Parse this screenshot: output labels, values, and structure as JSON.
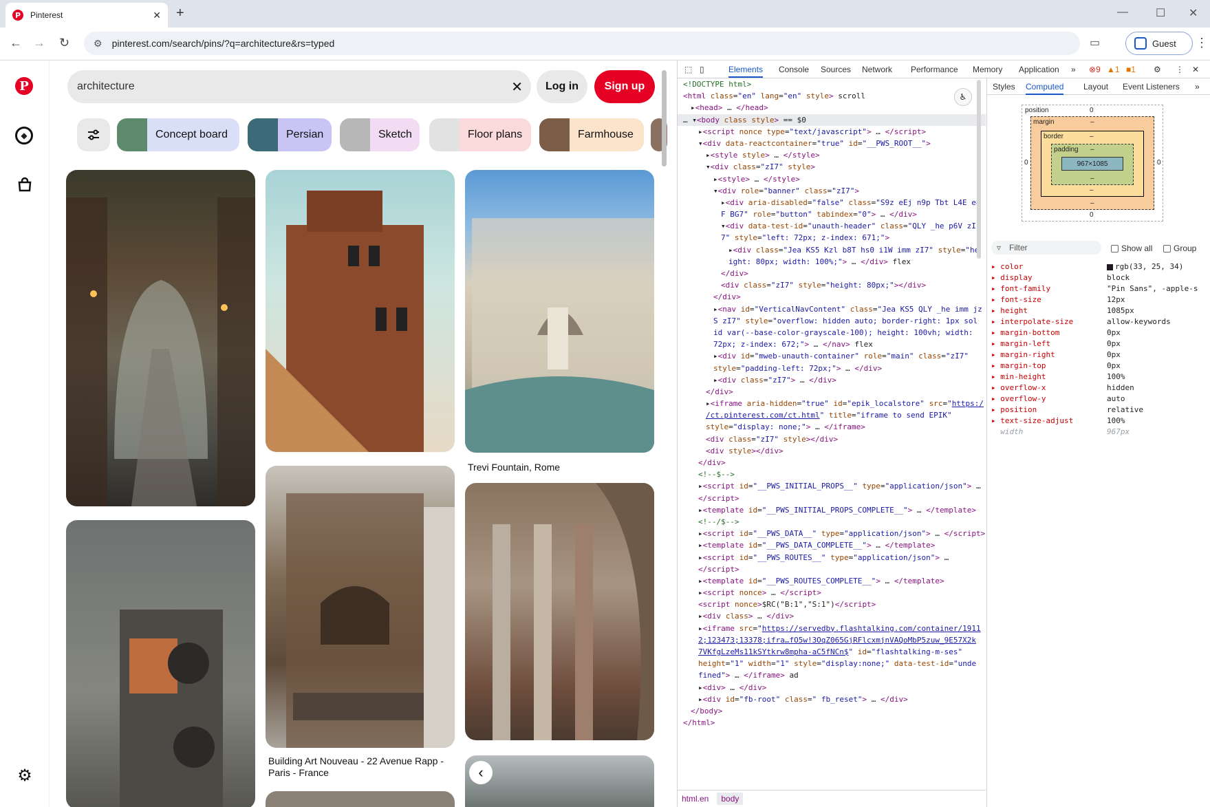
{
  "browser": {
    "tab_title": "Pinterest",
    "favicon_letter": "P",
    "new_tab": "+",
    "tab_close": "✕",
    "url": "pinterest.com/search/pins/?q=architecture&rs=typed",
    "profile": "Guest",
    "win_min": "—",
    "win_max": "☐",
    "win_close": "✕",
    "back": "←",
    "forward": "→",
    "reload": "↻"
  },
  "pinterest": {
    "logo": "P",
    "search_value": "architecture",
    "clear": "✕",
    "login": "Log in",
    "signup": "Sign up",
    "brand_color": "#e60023",
    "filters_icon": "⚙",
    "chips": [
      {
        "label": "Concept board",
        "color": "#dadff8",
        "thumb": "#5d8a6d"
      },
      {
        "label": "Persian",
        "color": "#c8c5f5",
        "thumb": "#3d6a78"
      },
      {
        "label": "Sketch",
        "color": "#f2dcf4",
        "thumb": "#b7b7b7"
      },
      {
        "label": "Floor plans",
        "color": "#fbdadc",
        "thumb": "#e2e2e2"
      },
      {
        "label": "Farmhouse",
        "color": "#fbe3cc",
        "thumb": "#7b5d48"
      }
    ],
    "captions": {
      "trevi": "Trevi Fountain, Rome",
      "nouveau_1": "Building Art Nouveau - 22 Avenue Rapp -",
      "nouveau_2": "Paris - France"
    },
    "carousel_prev": "‹"
  },
  "devtools": {
    "tabs": [
      "Elements",
      "Console",
      "Sources",
      "Network",
      "Performance",
      "Memory",
      "Application"
    ],
    "active_tab": "Elements",
    "more": "»",
    "errors": "9",
    "warnings": "1",
    "issues": "1",
    "dom_lines": [
      {
        "i": 0,
        "h": "<span class='cm'>&lt;!DOCTYPE html&gt;</span>"
      },
      {
        "i": 0,
        "h": "<span class='tg'>&lt;html</span> <span class='at'>class</span>=<span class='av'>\"en\"</span> <span class='at'>lang</span>=<span class='av'>\"en\"</span> <span class='at'>style</span><span class='tg'>&gt;</span> <span class='tx'>scroll</span>"
      },
      {
        "i": 1,
        "h": "▸<span class='tg'>&lt;head&gt;</span> … <span class='tg'>&lt;/head&gt;</span>"
      },
      {
        "i": 0,
        "h": "… ▾<span class='tg'>&lt;body</span> <span class='at'>class style</span><span class='tg'>&gt;</span> == $0",
        "sel": true
      },
      {
        "i": 2,
        "h": "▸<span class='tg'>&lt;script</span> <span class='at'>nonce type</span>=<span class='av'>\"text/javascript\"</span><span class='tg'>&gt;</span> … <span class='tg'>&lt;/script&gt;</span>"
      },
      {
        "i": 2,
        "h": "▾<span class='tg'>&lt;div</span> <span class='at'>data-reactcontainer</span>=<span class='av'>\"true\"</span> <span class='at'>id</span>=<span class='av'>\"__PWS_ROOT__\"</span><span class='tg'>&gt;</span>"
      },
      {
        "i": 3,
        "h": "▸<span class='tg'>&lt;style</span> <span class='at'>style</span><span class='tg'>&gt;</span> … <span class='tg'>&lt;/style&gt;</span>"
      },
      {
        "i": 3,
        "h": "▾<span class='tg'>&lt;div</span> <span class='at'>class</span>=<span class='av'>\"zI7\"</span> <span class='at'>style</span><span class='tg'>&gt;</span>"
      },
      {
        "i": 4,
        "h": "▸<span class='tg'>&lt;style&gt;</span> … <span class='tg'>&lt;/style&gt;</span>"
      },
      {
        "i": 4,
        "h": "▾<span class='tg'>&lt;div</span> <span class='at'>role</span>=<span class='av'>\"banner\"</span> <span class='at'>class</span>=<span class='av'>\"zI7\"</span><span class='tg'>&gt;</span>"
      },
      {
        "i": 5,
        "h": "▸<span class='tg'>&lt;div</span> <span class='at'>aria-disabled</span>=<span class='av'>\"false\"</span> <span class='at'>class</span>=<span class='av'>\"S9z eEj n9p Tbt L4E e8</span>"
      },
      {
        "i": 5,
        "h": "<span class='av'>F BG7\"</span> <span class='at'>role</span>=<span class='av'>\"button\"</span> <span class='at'>tabindex</span>=<span class='av'>\"0\"</span><span class='tg'>&gt;</span> … <span class='tg'>&lt;/div&gt;</span>"
      },
      {
        "i": 5,
        "h": "▾<span class='tg'>&lt;div</span> <span class='at'>data-test-id</span>=<span class='av'>\"unauth-header\"</span> <span class='at'>class</span>=<span class='av'>\"QLY _he p6V zI</span>"
      },
      {
        "i": 5,
        "h": "<span class='av'>7\"</span> <span class='at'>style</span>=<span class='av'>\"left: 72px; z-index: 671;\"</span><span class='tg'>&gt;</span>"
      },
      {
        "i": 6,
        "h": "▸<span class='tg'>&lt;div</span> <span class='at'>class</span>=<span class='av'>\"Jea KS5 Kzl b8T hs0 i1W imm zI7\"</span> <span class='at'>style</span>=<span class='av'>\"he</span>"
      },
      {
        "i": 6,
        "h": "<span class='av'>ight: 80px; width: 100%;\"</span><span class='tg'>&gt;</span> … <span class='tg'>&lt;/div&gt;</span> flex"
      },
      {
        "i": 5,
        "h": "<span class='tg'>&lt;/div&gt;</span>"
      },
      {
        "i": 5,
        "h": "<span class='tg'>&lt;div</span> <span class='at'>class</span>=<span class='av'>\"zI7\"</span> <span class='at'>style</span>=<span class='av'>\"height: 80px;\"</span><span class='tg'>&gt;&lt;/div&gt;</span>"
      },
      {
        "i": 4,
        "h": "<span class='tg'>&lt;/div&gt;</span>"
      },
      {
        "i": 4,
        "h": "▸<span class='tg'>&lt;nav</span> <span class='at'>id</span>=<span class='av'>\"VerticalNavContent\"</span> <span class='at'>class</span>=<span class='av'>\"Jea KS5 QLY _he imm jz</span>"
      },
      {
        "i": 4,
        "h": "<span class='av'>S zI7\"</span> <span class='at'>style</span>=<span class='av'>\"overflow: hidden auto; border-right: 1px sol</span>"
      },
      {
        "i": 4,
        "h": "<span class='av'>id var(--base-color-grayscale-100); height: 100vh; width:</span>"
      },
      {
        "i": 4,
        "h": "<span class='av'>72px; z-index: 672;\"</span><span class='tg'>&gt;</span> … <span class='tg'>&lt;/nav&gt;</span> flex"
      },
      {
        "i": 4,
        "h": "▸<span class='tg'>&lt;div</span> <span class='at'>id</span>=<span class='av'>\"mweb-unauth-container\"</span> <span class='at'>role</span>=<span class='av'>\"main\"</span> <span class='at'>class</span>=<span class='av'>\"zI7\"</span>"
      },
      {
        "i": 4,
        "h": "<span class='at'>style</span>=<span class='av'>\"padding-left: 72px;\"</span><span class='tg'>&gt;</span> … <span class='tg'>&lt;/div&gt;</span>"
      },
      {
        "i": 4,
        "h": "▸<span class='tg'>&lt;div</span> <span class='at'>class</span>=<span class='av'>\"zI7\"</span><span class='tg'>&gt;</span> … <span class='tg'>&lt;/div&gt;</span>"
      },
      {
        "i": 3,
        "h": "<span class='tg'>&lt;/div&gt;</span>"
      },
      {
        "i": 3,
        "h": "▸<span class='tg'>&lt;iframe</span> <span class='at'>aria-hidden</span>=<span class='av'>\"true\"</span> <span class='at'>id</span>=<span class='av'>\"epik_localstore\"</span> <span class='at'>src</span>=<span class='av'>\"</span><span class='lk'>https:/</span>"
      },
      {
        "i": 3,
        "h": "<span class='lk'>/ct.pinterest.com/ct.html</span><span class='av'>\"</span> <span class='at'>title</span>=<span class='av'>\"iframe to send EPIK\"</span>"
      },
      {
        "i": 3,
        "h": "<span class='at'>style</span>=<span class='av'>\"display: none;\"</span><span class='tg'>&gt;</span> … <span class='tg'>&lt;/iframe&gt;</span>"
      },
      {
        "i": 3,
        "h": "<span class='tg'>&lt;div</span> <span class='at'>class</span>=<span class='av'>\"zI7\"</span> <span class='at'>style</span><span class='tg'>&gt;&lt;/div&gt;</span>"
      },
      {
        "i": 3,
        "h": "<span class='tg'>&lt;div</span> <span class='at'>style</span><span class='tg'>&gt;&lt;/div&gt;</span>"
      },
      {
        "i": 2,
        "h": "<span class='tg'>&lt;/div&gt;</span>"
      },
      {
        "i": 2,
        "h": "<span class='cm'>&lt;!--$--&gt;</span>"
      },
      {
        "i": 2,
        "h": "▸<span class='tg'>&lt;script</span> <span class='at'>id</span>=<span class='av'>\"__PWS_INITIAL_PROPS__\"</span> <span class='at'>type</span>=<span class='av'>\"application/json\"</span><span class='tg'>&gt;</span> …"
      },
      {
        "i": 2,
        "h": "<span class='tg'>&lt;/script&gt;</span>"
      },
      {
        "i": 2,
        "h": "▸<span class='tg'>&lt;template</span> <span class='at'>id</span>=<span class='av'>\"__PWS_INITIAL_PROPS_COMPLETE__\"</span><span class='tg'>&gt;</span> … <span class='tg'>&lt;/template&gt;</span>"
      },
      {
        "i": 2,
        "h": "<span class='cm'>&lt;!--/$--&gt;</span>"
      },
      {
        "i": 2,
        "h": "▸<span class='tg'>&lt;script</span> <span class='at'>id</span>=<span class='av'>\"__PWS_DATA__\"</span> <span class='at'>type</span>=<span class='av'>\"application/json\"</span><span class='tg'>&gt;</span> … <span class='tg'>&lt;/script&gt;</span>"
      },
      {
        "i": 2,
        "h": "▸<span class='tg'>&lt;template</span> <span class='at'>id</span>=<span class='av'>\"__PWS_DATA_COMPLETE__\"</span><span class='tg'>&gt;</span> … <span class='tg'>&lt;/template&gt;</span>"
      },
      {
        "i": 2,
        "h": "▸<span class='tg'>&lt;script</span> <span class='at'>id</span>=<span class='av'>\"__PWS_ROUTES__\"</span> <span class='at'>type</span>=<span class='av'>\"application/json\"</span><span class='tg'>&gt;</span> …"
      },
      {
        "i": 2,
        "h": "<span class='tg'>&lt;/script&gt;</span>"
      },
      {
        "i": 2,
        "h": "▸<span class='tg'>&lt;template</span> <span class='at'>id</span>=<span class='av'>\"__PWS_ROUTES_COMPLETE__\"</span><span class='tg'>&gt;</span> … <span class='tg'>&lt;/template&gt;</span>"
      },
      {
        "i": 2,
        "h": "▸<span class='tg'>&lt;script</span> <span class='at'>nonce</span><span class='tg'>&gt;</span> … <span class='tg'>&lt;/script&gt;</span>"
      },
      {
        "i": 2,
        "h": "<span class='tg'>&lt;script</span> <span class='at'>nonce</span><span class='tg'>&gt;</span><span class='tx'>$RC(\"B:1\",\"S:1\")</span><span class='tg'>&lt;/script&gt;</span>"
      },
      {
        "i": 2,
        "h": "▸<span class='tg'>&lt;div</span> <span class='at'>class</span><span class='tg'>&gt;</span> … <span class='tg'>&lt;/div&gt;</span>"
      },
      {
        "i": 2,
        "h": "▸<span class='tg'>&lt;iframe</span> <span class='at'>src</span>=<span class='av'>\"</span><span class='lk'>https://servedby.flashtalking.com/container/1911</span>"
      },
      {
        "i": 2,
        "h": "<span class='lk'>2;123473;13378;ifra…fO5w!3OqZ065GjRFlcxmjnVAQoMbP5zuw_9E57X2k</span>"
      },
      {
        "i": 2,
        "h": "<span class='lk'>7VKfgLzeMs11kSYtkrw8mpha-aC5fNCn$</span><span class='av'>\"</span> <span class='at'>id</span>=<span class='av'>\"flashtalking-m-ses\"</span>"
      },
      {
        "i": 2,
        "h": "<span class='at'>height</span>=<span class='av'>\"1\"</span> <span class='at'>width</span>=<span class='av'>\"1\"</span> <span class='at'>style</span>=<span class='av'>\"display:none;\"</span> <span class='at'>data-test-id</span>=<span class='av'>\"unde</span>"
      },
      {
        "i": 2,
        "h": "<span class='av'>fined\"</span><span class='tg'>&gt;</span> … <span class='tg'>&lt;/iframe&gt;</span> ad"
      },
      {
        "i": 2,
        "h": "▸<span class='tg'>&lt;div&gt;</span> … <span class='tg'>&lt;/div&gt;</span>"
      },
      {
        "i": 2,
        "h": "▸<span class='tg'>&lt;div</span> <span class='at'>id</span>=<span class='av'>\"fb-root\"</span> <span class='at'>class</span>=<span class='av'>\" fb_reset\"</span><span class='tg'>&gt;</span> … <span class='tg'>&lt;/div&gt;</span>"
      },
      {
        "i": 1,
        "h": "<span class='tg'>&lt;/body&gt;</span>"
      },
      {
        "i": 0,
        "h": "<span class='tg'>&lt;/html&gt;</span>"
      }
    ],
    "breadcrumbs": [
      "html.en",
      "body"
    ],
    "side_tabs": [
      "Styles",
      "Computed",
      "Layout",
      "Event Listeners"
    ],
    "side_active": "Computed",
    "box": {
      "position_label": "position",
      "margin_label": "margin",
      "border_label": "border",
      "padding_label": "padding",
      "content": "967×1085",
      "zero": "0",
      "dash": "–"
    },
    "filter_placeholder": "Filter",
    "show_all": "Show all",
    "group": "Group",
    "computed": [
      {
        "name": "color",
        "value": "rgb(33, 25, 34)",
        "swatch": "#211922"
      },
      {
        "name": "display",
        "value": "block"
      },
      {
        "name": "font-family",
        "value": "\"Pin Sans\", -apple-s"
      },
      {
        "name": "font-size",
        "value": "12px"
      },
      {
        "name": "height",
        "value": "1085px"
      },
      {
        "name": "interpolate-size",
        "value": "allow-keywords"
      },
      {
        "name": "margin-bottom",
        "value": "0px"
      },
      {
        "name": "margin-left",
        "value": "0px"
      },
      {
        "name": "margin-right",
        "value": "0px"
      },
      {
        "name": "margin-top",
        "value": "0px"
      },
      {
        "name": "min-height",
        "value": "100%"
      },
      {
        "name": "overflow-x",
        "value": "hidden"
      },
      {
        "name": "overflow-y",
        "value": "auto"
      },
      {
        "name": "position",
        "value": "relative"
      },
      {
        "name": "text-size-adjust",
        "value": "100%"
      },
      {
        "name": "width",
        "value": "967px",
        "dim": true
      }
    ]
  }
}
